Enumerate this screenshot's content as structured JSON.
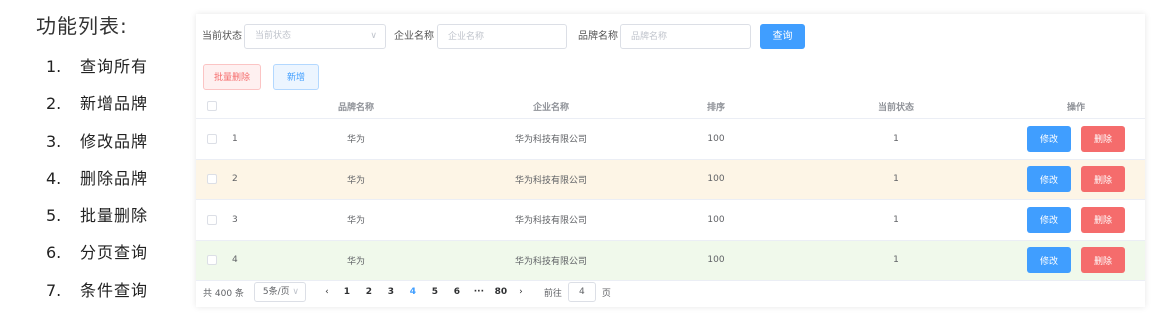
{
  "features": {
    "title": "功能列表:",
    "items": [
      {
        "num": "1.",
        "label": "查询所有"
      },
      {
        "num": "2.",
        "label": "新增品牌"
      },
      {
        "num": "3.",
        "label": "修改品牌"
      },
      {
        "num": "4.",
        "label": "删除品牌"
      },
      {
        "num": "5.",
        "label": "批量删除"
      },
      {
        "num": "6.",
        "label": "分页查询"
      },
      {
        "num": "7.",
        "label": "条件查询"
      }
    ]
  },
  "search": {
    "status_label": "当前状态",
    "status_placeholder": "当前状态",
    "company_label": "企业名称",
    "company_placeholder": "企业名称",
    "brand_label": "品牌名称",
    "brand_placeholder": "品牌名称",
    "query_button": "查询"
  },
  "actions": {
    "batch_delete": "批量删除",
    "add": "新增"
  },
  "table": {
    "headers": {
      "brand": "品牌名称",
      "company": "企业名称",
      "order": "排序",
      "status": "当前状态",
      "ops": "操作"
    },
    "rows": [
      {
        "idx": "1",
        "brand": "华为",
        "company": "华为科技有限公司",
        "order": "100",
        "status": "1",
        "edit": "修改",
        "delete": "删除"
      },
      {
        "idx": "2",
        "brand": "华为",
        "company": "华为科技有限公司",
        "order": "100",
        "status": "1",
        "edit": "修改",
        "delete": "删除"
      },
      {
        "idx": "3",
        "brand": "华为",
        "company": "华为科技有限公司",
        "order": "100",
        "status": "1",
        "edit": "修改",
        "delete": "删除"
      },
      {
        "idx": "4",
        "brand": "华为",
        "company": "华为科技有限公司",
        "order": "100",
        "status": "1",
        "edit": "修改",
        "delete": "删除"
      }
    ]
  },
  "pagination": {
    "total": "共 400 条",
    "page_size": "5条/页",
    "pages": [
      "1",
      "2",
      "3",
      "4",
      "5",
      "6",
      "···",
      "80"
    ],
    "current_page": "4",
    "jump_label": "前往",
    "jump_value": "4",
    "jump_suffix": "页"
  },
  "colors": {
    "primary": "#409eff",
    "danger": "#f56c6c",
    "row_warning": "#fdf5e6",
    "row_success": "#f0f9eb"
  },
  "icons": {
    "select_arrow": "chevron-down-icon",
    "prev": "chevron-left-icon",
    "next": "chevron-right-icon"
  }
}
